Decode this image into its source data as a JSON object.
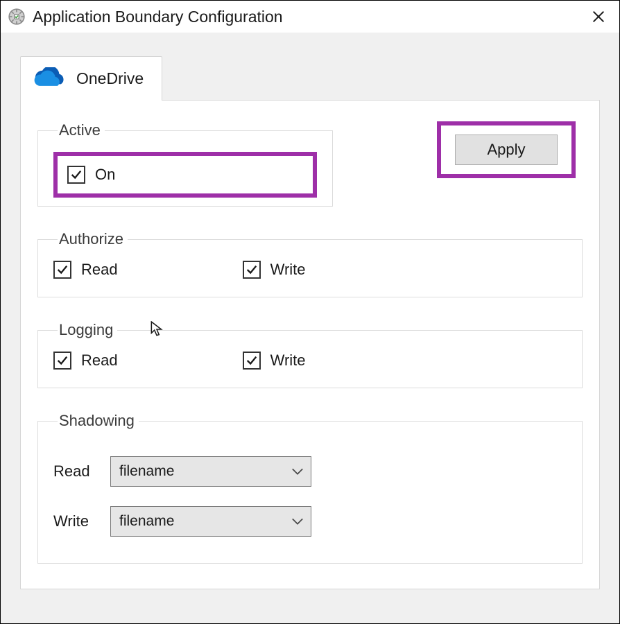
{
  "window": {
    "title": "Application Boundary Configuration"
  },
  "tab": {
    "label": "OneDrive"
  },
  "active": {
    "legend": "Active",
    "on_label": "On",
    "on_checked": true
  },
  "apply_label": "Apply",
  "authorize": {
    "legend": "Authorize",
    "read_label": "Read",
    "read_checked": true,
    "write_label": "Write",
    "write_checked": true
  },
  "logging": {
    "legend": "Logging",
    "read_label": "Read",
    "read_checked": true,
    "write_label": "Write",
    "write_checked": true
  },
  "shadowing": {
    "legend": "Shadowing",
    "read_label": "Read",
    "read_value": "filename",
    "write_label": "Write",
    "write_value": "filename"
  },
  "highlight_color": "#9e2fa8"
}
